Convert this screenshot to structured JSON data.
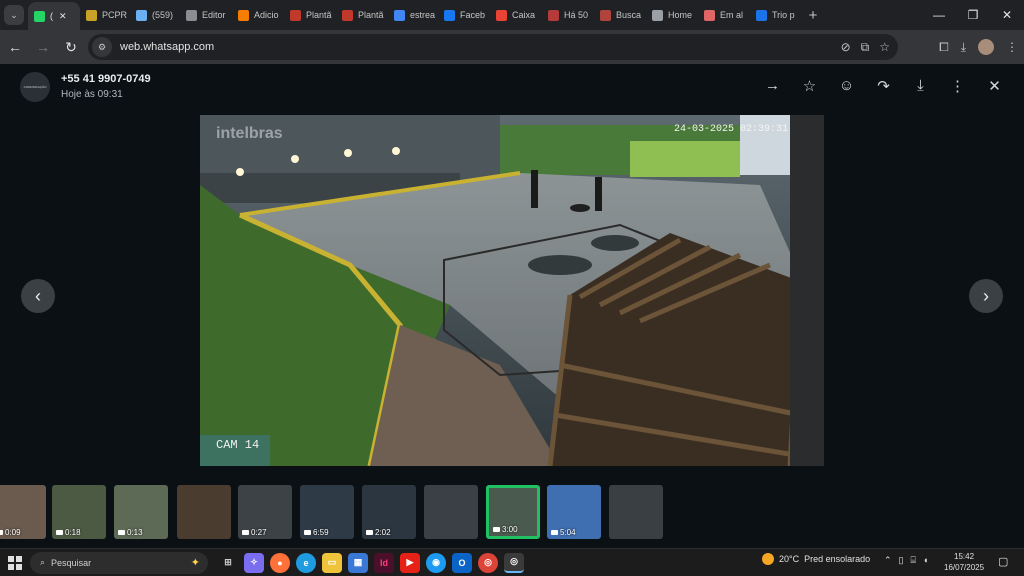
{
  "browser": {
    "tabs": [
      {
        "label": "(",
        "icon": "whatsapp-icon",
        "color": "#25d366",
        "active": true
      },
      {
        "label": "PCPR",
        "icon": "badge-icon",
        "color": "#c9a227"
      },
      {
        "label": "(559)",
        "icon": "globe-icon",
        "color": "#6ab0f3"
      },
      {
        "label": "Editor",
        "icon": "editor-icon",
        "color": "#8a8d91"
      },
      {
        "label": "Adicio",
        "icon": "blogger-icon",
        "color": "#f57d00"
      },
      {
        "label": "Plantã",
        "icon": "bp-icon",
        "color": "#c0392b"
      },
      {
        "label": "Plantã",
        "icon": "bp-icon",
        "color": "#c0392b"
      },
      {
        "label": "estrea",
        "icon": "google-icon",
        "color": "#4285f4"
      },
      {
        "label": "Faceb",
        "icon": "facebook-icon",
        "color": "#1877f2"
      },
      {
        "label": "Caixa",
        "icon": "gmail-icon",
        "color": "#ea4335"
      },
      {
        "label": "Há 50",
        "icon": "news-icon",
        "color": "#b53a3a"
      },
      {
        "label": "Busca",
        "icon": "search-site-icon",
        "color": "#b0443a"
      },
      {
        "label": "Home",
        "icon": "home-icon",
        "color": "#9aa0a6"
      },
      {
        "label": "Em al",
        "icon": "chart-icon",
        "color": "#e06666"
      },
      {
        "label": "Trio p",
        "icon": "t-icon",
        "color": "#1a73e8"
      }
    ],
    "url": "web.whatsapp.com"
  },
  "viewer": {
    "sender": "+55 41 9907-0749",
    "time": "Hoje às 09:31",
    "avatar_text": "COMUNICAÇÃO",
    "media": {
      "brand": "intelbras",
      "timestamp": "24-03-2025 02:39:31",
      "camera": "CAM 14"
    }
  },
  "thumbnails": [
    {
      "duration": "0:09",
      "kind": "video",
      "selected": false
    },
    {
      "duration": "0:18",
      "kind": "video",
      "selected": false
    },
    {
      "duration": "0:13",
      "kind": "video",
      "selected": false
    },
    {
      "duration": "",
      "kind": "image",
      "selected": false
    },
    {
      "duration": "0:27",
      "kind": "video",
      "selected": false
    },
    {
      "duration": "6:59",
      "kind": "video",
      "selected": false
    },
    {
      "duration": "2:02",
      "kind": "video",
      "selected": false
    },
    {
      "duration": "",
      "kind": "image",
      "selected": false
    },
    {
      "duration": "3:00",
      "kind": "video",
      "selected": true
    },
    {
      "duration": "5:04",
      "kind": "video",
      "selected": false
    },
    {
      "duration": "",
      "kind": "image",
      "selected": false
    }
  ],
  "taskbar": {
    "search_placeholder": "Pesquisar",
    "weather_temp": "20°C",
    "weather_desc": "Pred ensolarado",
    "time": "15:42",
    "date": "16/07/2025"
  }
}
